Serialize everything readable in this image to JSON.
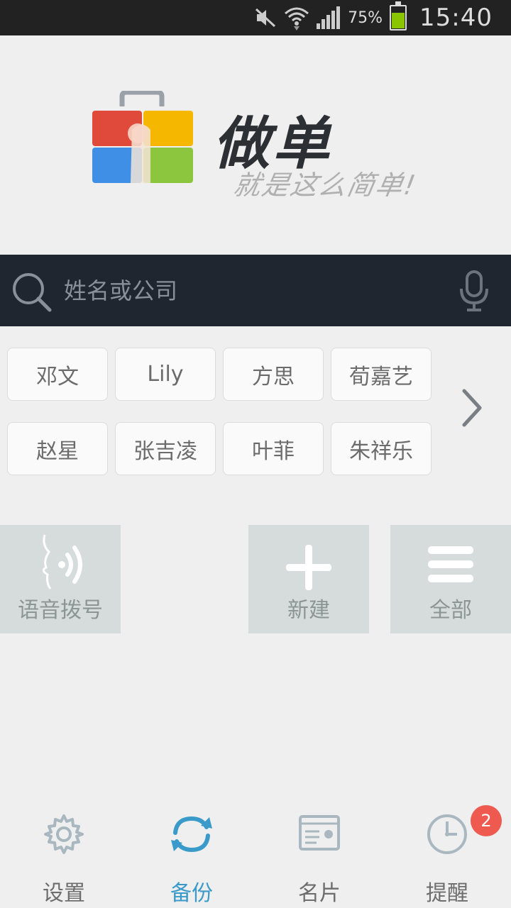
{
  "status_bar": {
    "battery_percent": "75%",
    "time": "15:40",
    "icons": [
      "mute-icon",
      "wifi-icon",
      "signal-icon",
      "battery-icon"
    ]
  },
  "logo": {
    "title": "做单",
    "slogan": "就是这么简单!"
  },
  "search": {
    "placeholder": "姓名或公司"
  },
  "contacts": [
    {
      "name": "邓文"
    },
    {
      "name": "Lily"
    },
    {
      "name": "方思"
    },
    {
      "name": "荀嘉艺"
    },
    {
      "name": "赵星"
    },
    {
      "name": "张吉凌"
    },
    {
      "name": "叶菲"
    },
    {
      "name": "朱祥乐"
    }
  ],
  "actions": {
    "voice_dial": "语音拨号",
    "new": "新建",
    "all": "全部"
  },
  "bottom_nav": {
    "settings": "设置",
    "backup": "备份",
    "card": "名片",
    "reminder": "提醒",
    "reminder_badge": "2"
  },
  "colors": {
    "search_bg": "#1f2630",
    "accent": "#3a9ac9",
    "badge": "#ee5a50",
    "tile_bg": "#d6dcdc"
  }
}
